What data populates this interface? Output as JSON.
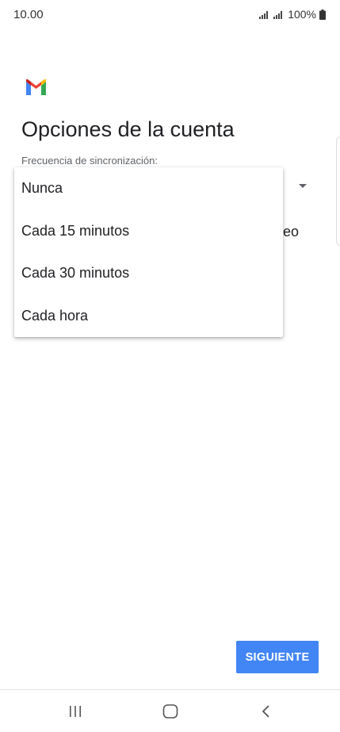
{
  "status_bar": {
    "time": "10.00",
    "battery": "100%"
  },
  "page": {
    "title": "Opciones de la cuenta",
    "sync_label": "Frecuencia de sincronización:",
    "behind_text": "eo"
  },
  "dropdown": {
    "options": [
      "Nunca",
      "Cada 15 minutos",
      "Cada 30 minutos",
      "Cada hora"
    ]
  },
  "next_button": {
    "label": "SIGUIENTE"
  },
  "colors": {
    "accent": "#4285f4",
    "gmail_red": "#ea4335",
    "gmail_blue": "#4285f4",
    "gmail_green": "#34a853",
    "gmail_yellow": "#fbbc04"
  },
  "icons": {
    "signal": "signal-bars-icon",
    "battery": "battery-icon",
    "logo": "gmail-logo-icon",
    "recents": "recents-icon",
    "home": "home-icon",
    "back": "back-icon"
  }
}
